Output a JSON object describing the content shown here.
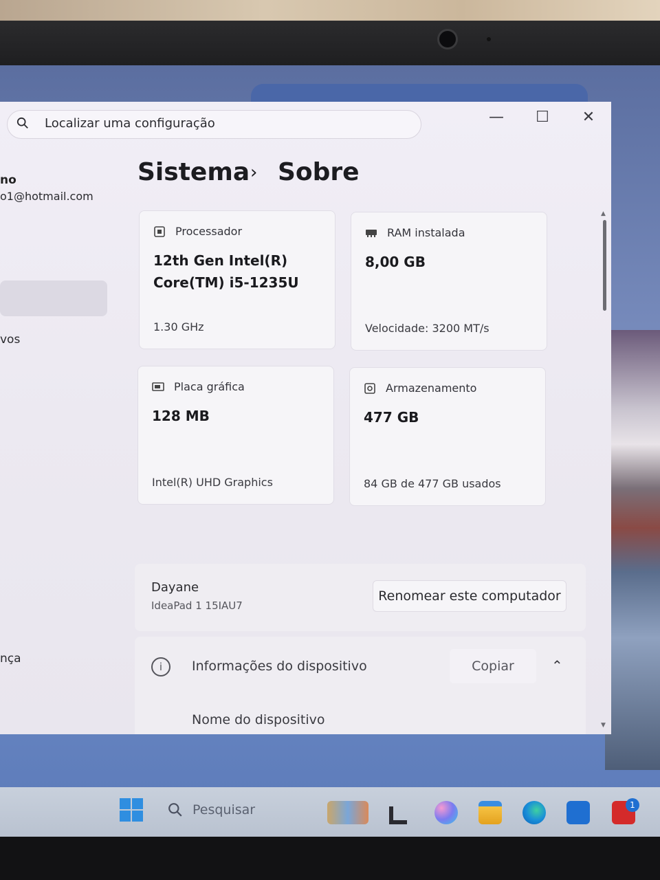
{
  "window": {
    "search_placeholder": "Localizar uma configuração",
    "controls": {
      "minimize": "—",
      "maximize": "☐",
      "close": "✕"
    }
  },
  "sidebar": {
    "user_name": "no",
    "user_email": "o1@hotmail.com",
    "items": [
      {
        "label": "vos"
      },
      {
        "label": "nça"
      }
    ]
  },
  "breadcrumb": {
    "parent": "Sistema",
    "separator": "›",
    "current": "Sobre"
  },
  "specs": {
    "processor": {
      "label": "Processador",
      "value": "12th Gen Intel(R) Core(TM) i5-1235U",
      "footer": "1.30 GHz",
      "icon": "processor-icon"
    },
    "ram": {
      "label": "RAM instalada",
      "value": "8,00 GB",
      "footer": "Velocidade: 3200 MT/s",
      "icon": "ram-icon"
    },
    "gpu": {
      "label": "Placa gráfica",
      "value": "128 MB",
      "footer": "Intel(R) UHD Graphics",
      "icon": "gpu-icon"
    },
    "storage": {
      "label": "Armazenamento",
      "value": "477 GB",
      "footer": "84 GB de 477 GB usados",
      "icon": "storage-icon"
    }
  },
  "device": {
    "name": "Dayane",
    "model": "IdeaPad 1 15IAU7",
    "rename_label": "Renomear este computador"
  },
  "device_info": {
    "title": "Informações do dispositivo",
    "copy_label": "Copiar",
    "row_label": "Nome do dispositivo"
  },
  "taskbar": {
    "search_placeholder": "Pesquisar",
    "badge_count": "1",
    "apps": [
      "widgets-icon",
      "task-view-icon",
      "copilot-icon",
      "file-explorer-icon",
      "edge-icon",
      "store-icon",
      "lenovo-app-icon"
    ]
  }
}
